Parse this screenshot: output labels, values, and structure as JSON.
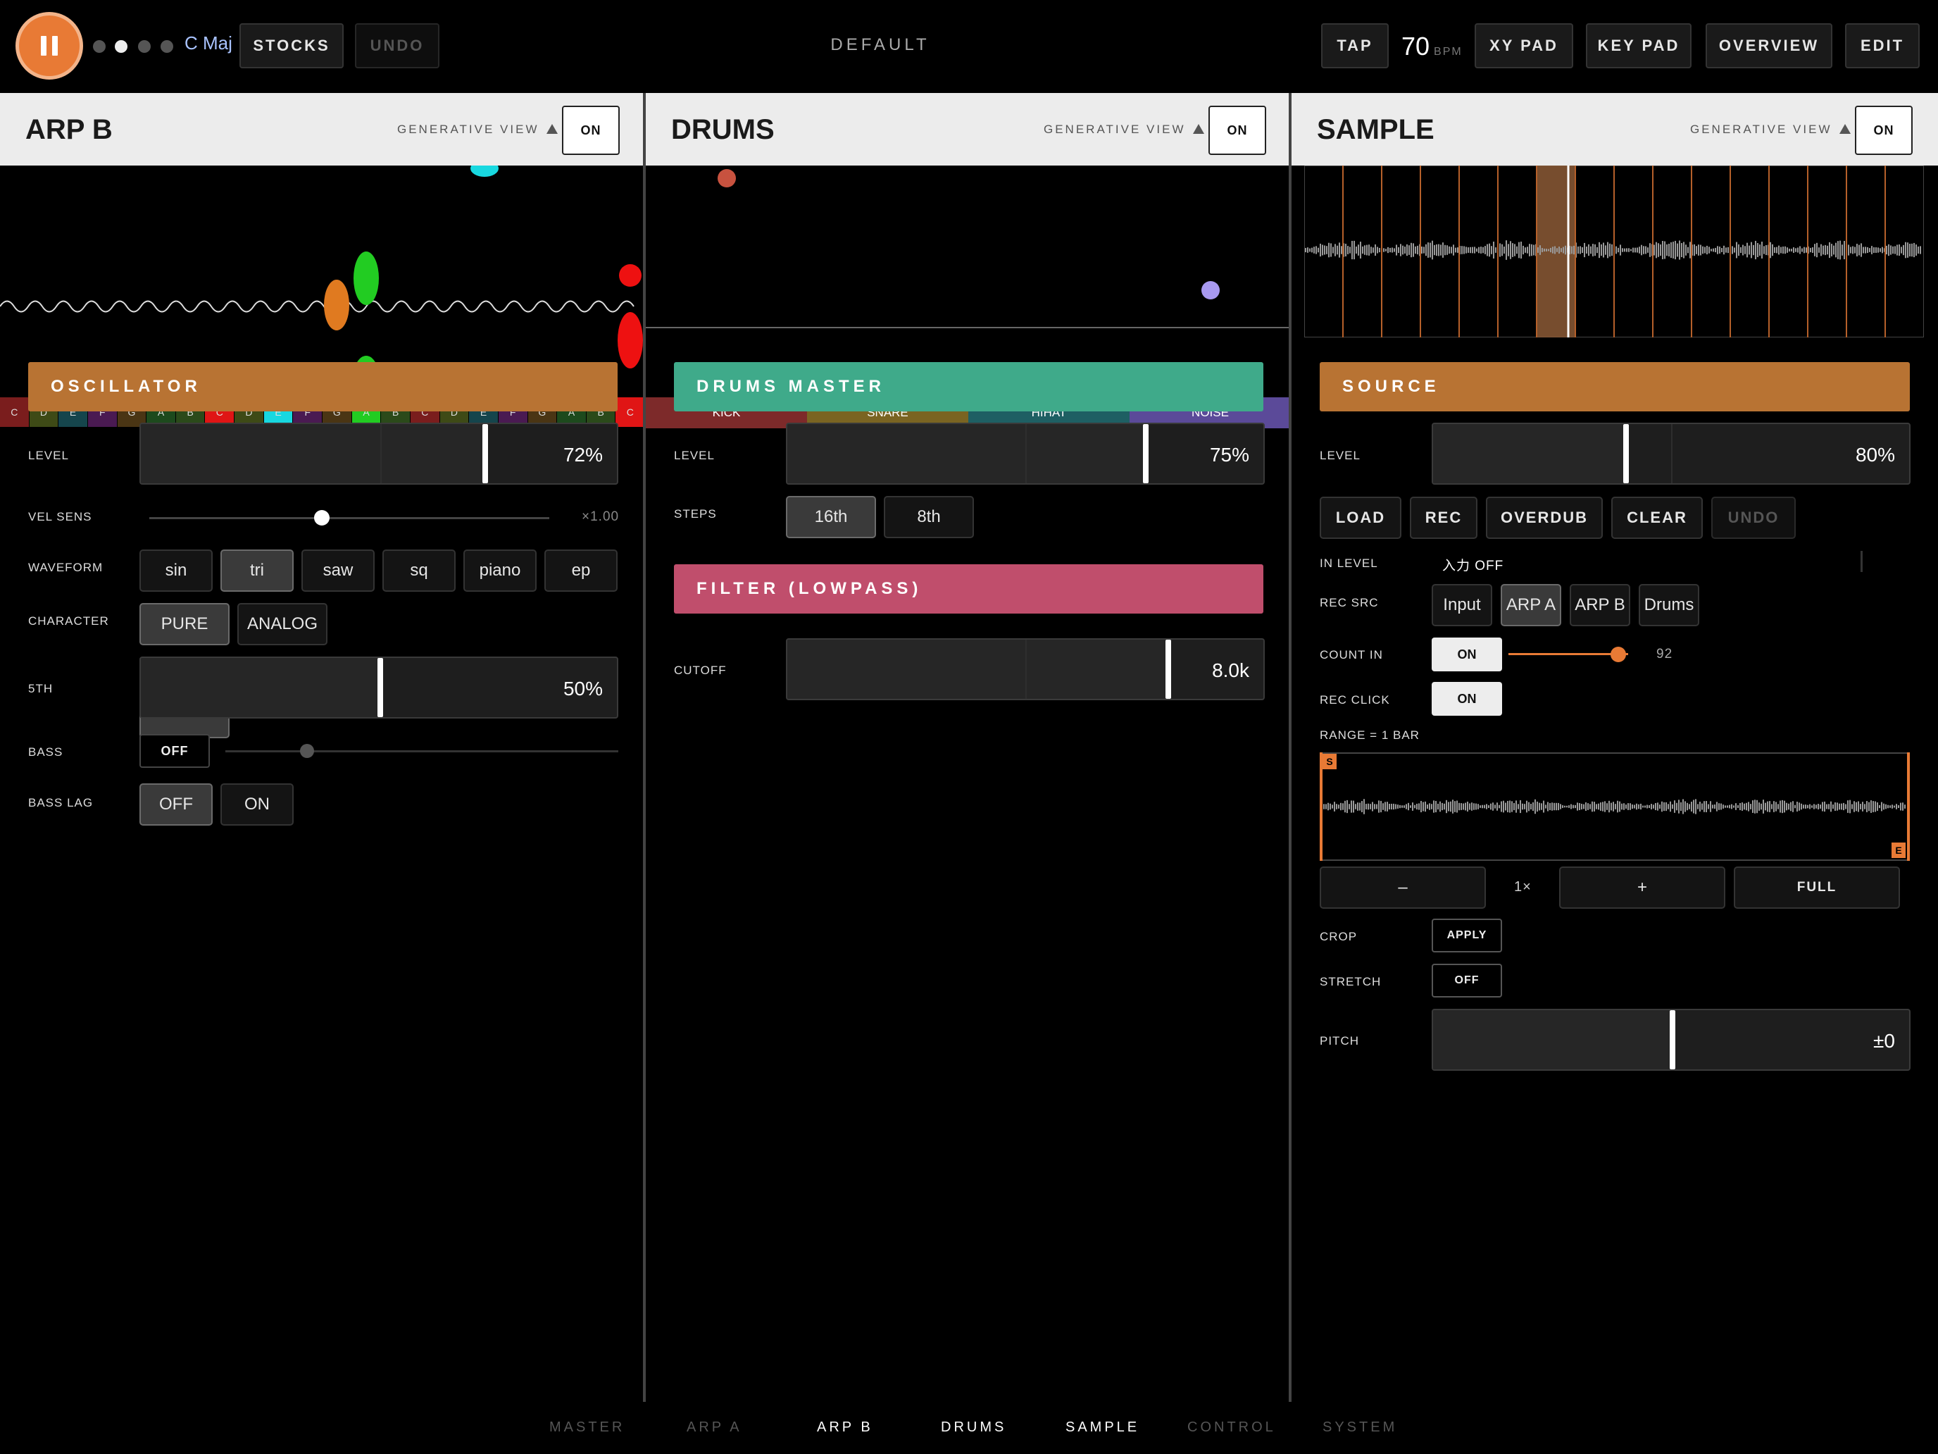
{
  "topbar": {
    "scale": "C Maj",
    "stocks": "STOCKS",
    "undo": "UNDO",
    "preset": "DEFAULT",
    "tap": "TAP",
    "bpm_value": "70",
    "bpm_unit": "BPM",
    "xy_pad": "XY PAD",
    "key_pad": "KEY PAD",
    "overview": "OVERVIEW",
    "edit": "EDIT"
  },
  "arpb": {
    "title": "ARP B",
    "generative_view": "GENERATIVE VIEW",
    "on": "ON",
    "keys": [
      "C",
      "D",
      "E",
      "F",
      "G",
      "A",
      "B",
      "C",
      "D",
      "E",
      "F",
      "G",
      "A",
      "B",
      "C",
      "D",
      "E",
      "F",
      "G",
      "A",
      "B",
      "C"
    ],
    "oscillator": "OSCILLATOR",
    "level_label": "LEVEL",
    "level_value": "72%",
    "level_fraction": 0.72,
    "vel_sens_label": "VEL SENS",
    "vel_sens_value": "×1.00",
    "vel_sens_fraction": 0.43,
    "waveform_label": "WAVEFORM",
    "waveforms": [
      "sin",
      "tri",
      "saw",
      "sq",
      "piano",
      "ep"
    ],
    "waveform_selected": "tri",
    "character_label": "CHARACTER",
    "character_pure": "PURE",
    "character_analog": "ANALOG",
    "fifth_label": "5TH",
    "fifth_value": "50%",
    "fifth_fraction": 0.5,
    "bass_label": "BASS",
    "bass_toggle": "OFF",
    "bass_fraction": 0.2,
    "bass_lag_label": "BASS LAG",
    "bass_lag_off": "OFF",
    "bass_lag_on": "ON"
  },
  "drums": {
    "title": "DRUMS",
    "generative_view": "GENERATIVE VIEW",
    "on": "ON",
    "tabs": [
      "KICK",
      "SNARE",
      "HIHAT",
      "NOISE"
    ],
    "master": "DRUMS MASTER",
    "level_label": "LEVEL",
    "level_value": "75%",
    "level_fraction": 0.75,
    "steps_label": "STEPS",
    "step_16": "16th",
    "step_8": "8th",
    "filter": "FILTER (LOWPASS)",
    "cutoff_label": "CUTOFF",
    "cutoff_value": "8.0k"
  },
  "sample": {
    "title": "SAMPLE",
    "generative_view": "GENERATIVE VIEW",
    "on": "ON",
    "source": "SOURCE",
    "level_label": "LEVEL",
    "level_value": "80%",
    "level_fraction": 0.4,
    "load": "LOAD",
    "rec": "REC",
    "overdub": "OVERDUB",
    "clear": "CLEAR",
    "undo": "UNDO",
    "in_level_label": "IN LEVEL",
    "in_level_value": "入力 OFF",
    "rec_src_label": "REC SRC",
    "rec_src": [
      "Input",
      "ARP A",
      "ARP B",
      "Drums"
    ],
    "rec_src_selected": "ARP A",
    "count_in_label": "COUNT IN",
    "count_in_toggle": "ON",
    "count_in_value": "92",
    "count_in_fraction": 0.9,
    "rec_click_label": "REC CLICK",
    "rec_click_toggle": "ON",
    "range_label": "RANGE = 1 BAR",
    "marker_start": "S",
    "marker_end": "E",
    "zoom_minus": "–",
    "zoom_value": "1×",
    "zoom_plus": "+",
    "full": "FULL",
    "crop_label": "CROP",
    "apply": "APPLY",
    "stretch_label": "STRETCH",
    "stretch_toggle": "OFF",
    "pitch_label": "PITCH",
    "pitch_value": "±0"
  },
  "nav": {
    "items": [
      "MASTER",
      "ARP A",
      "ARP B",
      "DRUMS",
      "SAMPLE",
      "CONTROL",
      "SYSTEM"
    ]
  },
  "colors": {
    "accent_orange": "#e87a35",
    "osc_bar": "#b87333",
    "drums_master": "#3faa8a",
    "filter_bar": "#c04e6c"
  }
}
